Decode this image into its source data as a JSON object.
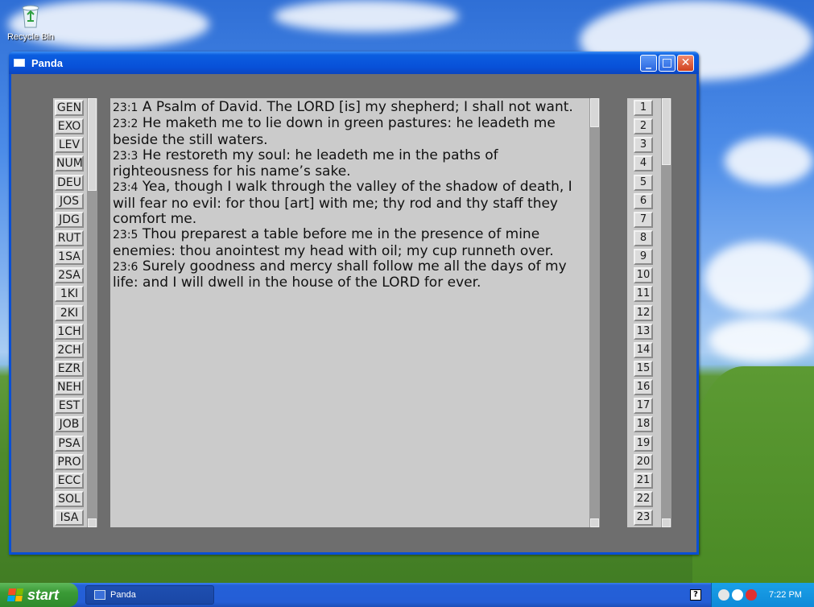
{
  "desktop": {
    "recycle_bin_label": "Recycle Bin"
  },
  "window": {
    "title": "Panda",
    "controls": {
      "minimize": "_",
      "maximize": "□",
      "close": "✕"
    }
  },
  "books": [
    "GEN",
    "EXO",
    "LEV",
    "NUM",
    "DEU",
    "JOS",
    "JDG",
    "RUT",
    "1SA",
    "2SA",
    "1KI",
    "2KI",
    "1CH",
    "2CH",
    "EZR",
    "NEH",
    "EST",
    "JOB",
    "PSA",
    "PRO",
    "ECC",
    "SOL",
    "ISA"
  ],
  "verses": [
    {
      "ref": "23:1",
      "text": "A Psalm of David. The LORD [is] my shepherd; I shall not want."
    },
    {
      "ref": "23:2",
      "text": "He maketh me to lie down in green pastures: he leadeth me beside the still waters."
    },
    {
      "ref": "23:3",
      "text": "He restoreth my soul: he leadeth me in the paths of righteousness for his name’s sake."
    },
    {
      "ref": "23:4",
      "text": "Yea, though I walk through the valley of the shadow of death, I will fear no evil: for thou [art] with me; thy rod and thy staff they comfort me."
    },
    {
      "ref": "23:5",
      "text": "Thou preparest a table before me in the presence of mine enemies: thou anointest my head with oil; my cup runneth over."
    },
    {
      "ref": "23:6",
      "text": "Surely goodness and mercy shall follow me all the days of my life: and I will dwell in the house of the LORD for ever."
    }
  ],
  "chapters": [
    "1",
    "2",
    "3",
    "4",
    "5",
    "6",
    "7",
    "8",
    "9",
    "10",
    "11",
    "12",
    "13",
    "14",
    "15",
    "16",
    "17",
    "18",
    "19",
    "20",
    "21",
    "22",
    "23"
  ],
  "scroll": {
    "books": {
      "top_fraction": 0.0,
      "size_fraction": 0.22
    },
    "text": {
      "top_fraction": 0.0,
      "size_fraction": 0.07
    },
    "chapters": {
      "top_fraction": 0.0,
      "size_fraction": 0.16
    }
  },
  "taskbar": {
    "start_label": "start",
    "task_label": "Panda",
    "help_glyph": "?",
    "clock": "7:22 PM"
  },
  "colors": {
    "start_flag": [
      "#f25022",
      "#7fba00",
      "#00a4ef",
      "#ffb900"
    ],
    "tray_icons": [
      "#e6e6e6",
      "#ffffff",
      "#e03030"
    ]
  }
}
